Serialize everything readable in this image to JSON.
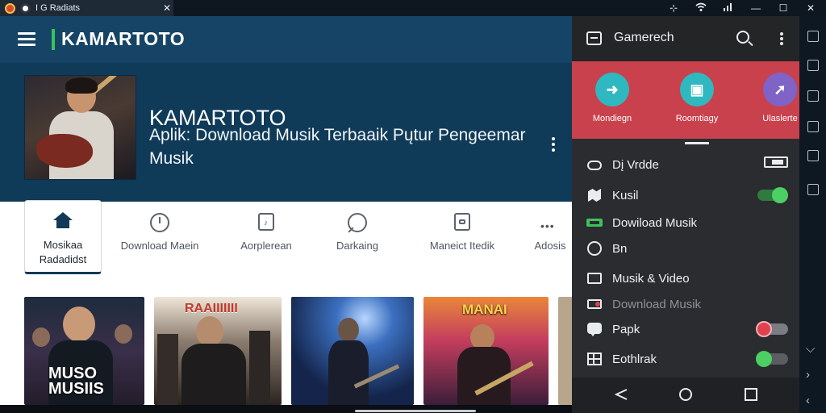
{
  "window": {
    "tab_title": "I G Radiats",
    "tab_close": "✕",
    "sys_icons": [
      "⊹",
      "wifi",
      "signal",
      "—",
      "☐",
      "✕"
    ]
  },
  "app": {
    "brand": "KAMARTOTO",
    "hero_title": "KAMARTOTO",
    "hero_subtitle": "Aplik: Download Musik Terbaaik Pųtur Pengeemar Musik",
    "nav": [
      {
        "label": "Mosikaa Radadidst",
        "icon": "home-icon",
        "active": true
      },
      {
        "label": "Download Maein",
        "icon": "clock-icon"
      },
      {
        "label": "Aorplerean",
        "icon": "note-icon"
      },
      {
        "label": "Darkaing",
        "icon": "search-icon"
      },
      {
        "label": "Maneict Itedik",
        "icon": "lock-icon"
      },
      {
        "label": "Adosis",
        "icon": "more-icon"
      }
    ],
    "gallery": [
      {
        "caption": "MUSO MUSIIS"
      },
      {
        "caption": "RAAIIIIIII"
      },
      {
        "caption": ""
      },
      {
        "caption": "MANAI"
      },
      {
        "caption": ""
      }
    ]
  },
  "drawer": {
    "title": "Gamerech",
    "share": [
      {
        "label": "Mondiegn",
        "color": "#2fb8bf",
        "glyph": "➜"
      },
      {
        "label": "Roomtiagy",
        "color": "#2fb8bf",
        "glyph": "▣"
      },
      {
        "label": "Ulaslerte",
        "color": "#7f63c7",
        "glyph": "➚"
      }
    ],
    "items": [
      {
        "label": "Dį Vrdde",
        "icon": "cloud-icon",
        "control": "battery",
        "dim": false
      },
      {
        "label": "Kusil",
        "icon": "map-icon",
        "control": "toggle-green-on",
        "dim": false
      },
      {
        "label": "Dowiload Musik",
        "icon": "cassette-icon",
        "control": "",
        "dim": false
      },
      {
        "label": "Bn",
        "icon": "circle-icon",
        "control": "",
        "dim": false
      },
      {
        "label": "Musik & Video",
        "icon": "folder-icon",
        "control": "",
        "dim": false
      },
      {
        "label": "Download Musik",
        "icon": "record-icon",
        "control": "",
        "dim": true
      },
      {
        "label": "Papk",
        "icon": "chat-icon",
        "control": "toggle-red-on",
        "dim": false
      },
      {
        "label": "Eothlrak",
        "icon": "grid-icon",
        "control": "toggle-green",
        "dim": false
      }
    ],
    "colors": {
      "accent_red": "#c9414d",
      "toggle_green": "#4ccf63",
      "toggle_red": "#e0414e"
    }
  }
}
